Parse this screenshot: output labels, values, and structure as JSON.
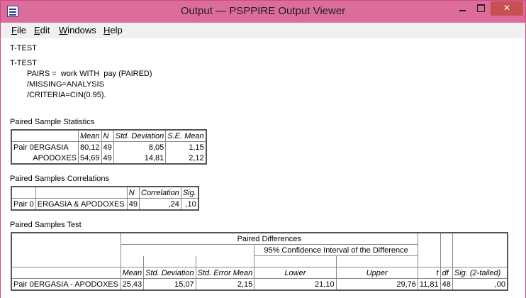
{
  "window": {
    "title": "Output — PSPPIRE Output Viewer"
  },
  "menu": {
    "file": "File",
    "edit": "Edit",
    "windows": "Windows",
    "help": "Help",
    "file_rest": "ile",
    "file_u": "F",
    "edit_rest": "dit",
    "edit_u": "E",
    "windows_rest": "indows",
    "windows_u": "W",
    "help_rest": "elp",
    "help_u": "H"
  },
  "output": {
    "heading1": "T-TEST",
    "heading2": "T-TEST",
    "syntax": [
      "PAIRS =  work WITH  pay (PAIRED)",
      "/MISSING=ANALYSIS",
      "/CRITERIA=CIN(0.95)."
    ],
    "stats": {
      "caption": "Paired Sample Statistics",
      "headers": [
        "Mean",
        "N",
        "Std. Deviation",
        "S.E. Mean"
      ],
      "pair": "Pair 0",
      "rows": [
        {
          "var": "ERGASIA",
          "mean": "80,12",
          "n": "49",
          "sd": "8,05",
          "se": "1,15"
        },
        {
          "var": "APODOXES",
          "mean": "54,69",
          "n": "49",
          "sd": "14,81",
          "se": "2,12"
        }
      ]
    },
    "corr": {
      "caption": "Paired Samples Correlations",
      "headers": [
        "N",
        "Correlation",
        "Sig."
      ],
      "pair": "Pair 0",
      "row": {
        "label": "ERGASIA & APODOXES",
        "n": "49",
        "corr": ",24",
        "sig": ",10"
      }
    },
    "test": {
      "caption": "Paired Samples Test",
      "group": "Paired Differences",
      "ci": "95% Confidence Interval of the Difference",
      "headers": {
        "mean": "Mean",
        "sd": "Std. Deviation",
        "se": "Std. Error Mean",
        "lower": "Lower",
        "upper": "Upper",
        "t": "t",
        "df": "df",
        "sig": "Sig. (2-tailed)"
      },
      "pair": "Pair 0",
      "row": {
        "label": "ERGASIA - APODOXES",
        "mean": "25,43",
        "sd": "15,07",
        "se": "2,15",
        "lower": "21,10",
        "upper": "29,76",
        "t": "11,81",
        "df": "48",
        "sig": ",00"
      }
    }
  }
}
